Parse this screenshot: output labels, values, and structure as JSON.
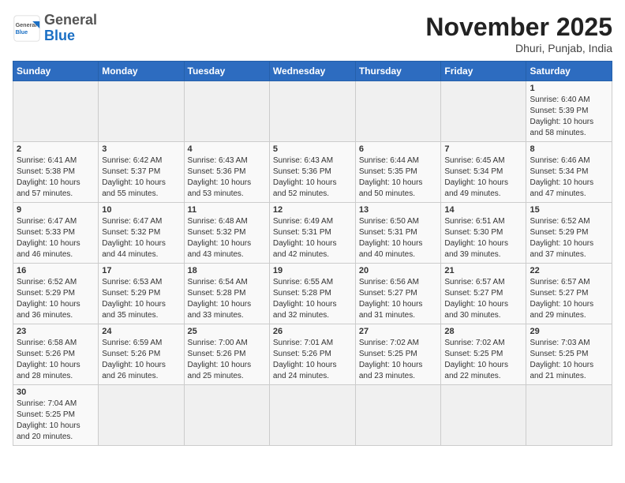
{
  "header": {
    "logo_general": "General",
    "logo_blue": "Blue",
    "month_title": "November 2025",
    "subtitle": "Dhuri, Punjab, India"
  },
  "days_of_week": [
    "Sunday",
    "Monday",
    "Tuesday",
    "Wednesday",
    "Thursday",
    "Friday",
    "Saturday"
  ],
  "weeks": [
    [
      {
        "num": "",
        "info": ""
      },
      {
        "num": "",
        "info": ""
      },
      {
        "num": "",
        "info": ""
      },
      {
        "num": "",
        "info": ""
      },
      {
        "num": "",
        "info": ""
      },
      {
        "num": "",
        "info": ""
      },
      {
        "num": "1",
        "info": "Sunrise: 6:40 AM\nSunset: 5:39 PM\nDaylight: 10 hours\nand 58 minutes."
      }
    ],
    [
      {
        "num": "2",
        "info": "Sunrise: 6:41 AM\nSunset: 5:38 PM\nDaylight: 10 hours\nand 57 minutes."
      },
      {
        "num": "3",
        "info": "Sunrise: 6:42 AM\nSunset: 5:37 PM\nDaylight: 10 hours\nand 55 minutes."
      },
      {
        "num": "4",
        "info": "Sunrise: 6:43 AM\nSunset: 5:36 PM\nDaylight: 10 hours\nand 53 minutes."
      },
      {
        "num": "5",
        "info": "Sunrise: 6:43 AM\nSunset: 5:36 PM\nDaylight: 10 hours\nand 52 minutes."
      },
      {
        "num": "6",
        "info": "Sunrise: 6:44 AM\nSunset: 5:35 PM\nDaylight: 10 hours\nand 50 minutes."
      },
      {
        "num": "7",
        "info": "Sunrise: 6:45 AM\nSunset: 5:34 PM\nDaylight: 10 hours\nand 49 minutes."
      },
      {
        "num": "8",
        "info": "Sunrise: 6:46 AM\nSunset: 5:34 PM\nDaylight: 10 hours\nand 47 minutes."
      }
    ],
    [
      {
        "num": "9",
        "info": "Sunrise: 6:47 AM\nSunset: 5:33 PM\nDaylight: 10 hours\nand 46 minutes."
      },
      {
        "num": "10",
        "info": "Sunrise: 6:47 AM\nSunset: 5:32 PM\nDaylight: 10 hours\nand 44 minutes."
      },
      {
        "num": "11",
        "info": "Sunrise: 6:48 AM\nSunset: 5:32 PM\nDaylight: 10 hours\nand 43 minutes."
      },
      {
        "num": "12",
        "info": "Sunrise: 6:49 AM\nSunset: 5:31 PM\nDaylight: 10 hours\nand 42 minutes."
      },
      {
        "num": "13",
        "info": "Sunrise: 6:50 AM\nSunset: 5:31 PM\nDaylight: 10 hours\nand 40 minutes."
      },
      {
        "num": "14",
        "info": "Sunrise: 6:51 AM\nSunset: 5:30 PM\nDaylight: 10 hours\nand 39 minutes."
      },
      {
        "num": "15",
        "info": "Sunrise: 6:52 AM\nSunset: 5:29 PM\nDaylight: 10 hours\nand 37 minutes."
      }
    ],
    [
      {
        "num": "16",
        "info": "Sunrise: 6:52 AM\nSunset: 5:29 PM\nDaylight: 10 hours\nand 36 minutes."
      },
      {
        "num": "17",
        "info": "Sunrise: 6:53 AM\nSunset: 5:29 PM\nDaylight: 10 hours\nand 35 minutes."
      },
      {
        "num": "18",
        "info": "Sunrise: 6:54 AM\nSunset: 5:28 PM\nDaylight: 10 hours\nand 33 minutes."
      },
      {
        "num": "19",
        "info": "Sunrise: 6:55 AM\nSunset: 5:28 PM\nDaylight: 10 hours\nand 32 minutes."
      },
      {
        "num": "20",
        "info": "Sunrise: 6:56 AM\nSunset: 5:27 PM\nDaylight: 10 hours\nand 31 minutes."
      },
      {
        "num": "21",
        "info": "Sunrise: 6:57 AM\nSunset: 5:27 PM\nDaylight: 10 hours\nand 30 minutes."
      },
      {
        "num": "22",
        "info": "Sunrise: 6:57 AM\nSunset: 5:27 PM\nDaylight: 10 hours\nand 29 minutes."
      }
    ],
    [
      {
        "num": "23",
        "info": "Sunrise: 6:58 AM\nSunset: 5:26 PM\nDaylight: 10 hours\nand 28 minutes."
      },
      {
        "num": "24",
        "info": "Sunrise: 6:59 AM\nSunset: 5:26 PM\nDaylight: 10 hours\nand 26 minutes."
      },
      {
        "num": "25",
        "info": "Sunrise: 7:00 AM\nSunset: 5:26 PM\nDaylight: 10 hours\nand 25 minutes."
      },
      {
        "num": "26",
        "info": "Sunrise: 7:01 AM\nSunset: 5:26 PM\nDaylight: 10 hours\nand 24 minutes."
      },
      {
        "num": "27",
        "info": "Sunrise: 7:02 AM\nSunset: 5:25 PM\nDaylight: 10 hours\nand 23 minutes."
      },
      {
        "num": "28",
        "info": "Sunrise: 7:02 AM\nSunset: 5:25 PM\nDaylight: 10 hours\nand 22 minutes."
      },
      {
        "num": "29",
        "info": "Sunrise: 7:03 AM\nSunset: 5:25 PM\nDaylight: 10 hours\nand 21 minutes."
      }
    ],
    [
      {
        "num": "30",
        "info": "Sunrise: 7:04 AM\nSunset: 5:25 PM\nDaylight: 10 hours\nand 20 minutes."
      },
      {
        "num": "",
        "info": ""
      },
      {
        "num": "",
        "info": ""
      },
      {
        "num": "",
        "info": ""
      },
      {
        "num": "",
        "info": ""
      },
      {
        "num": "",
        "info": ""
      },
      {
        "num": "",
        "info": ""
      }
    ]
  ]
}
